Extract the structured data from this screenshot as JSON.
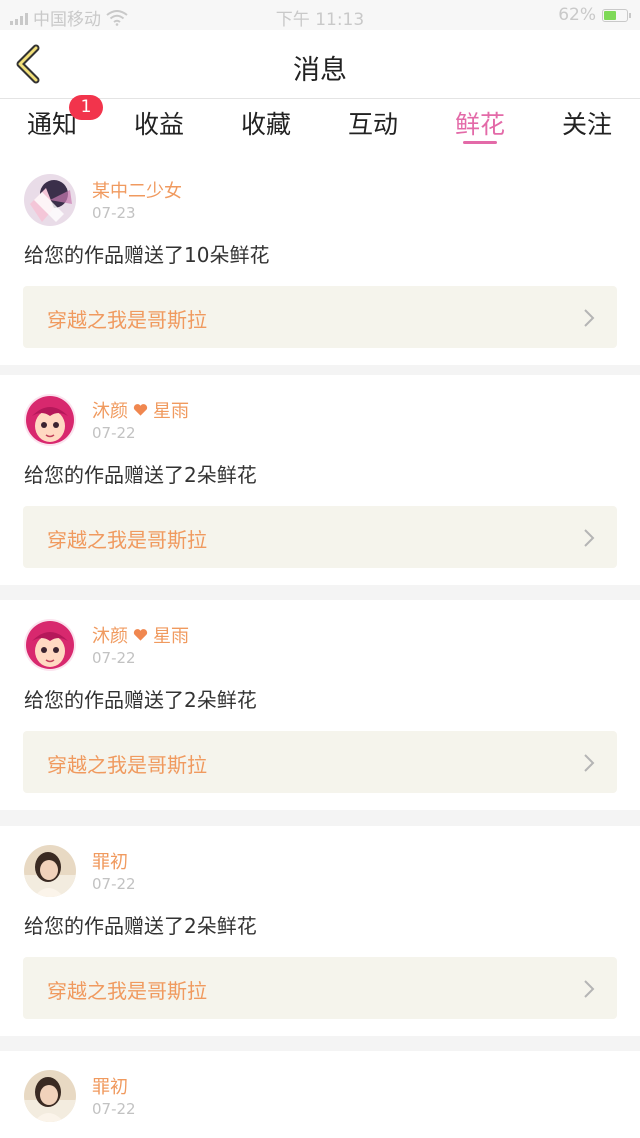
{
  "status_bar": {
    "carrier": "中国移动",
    "time": "下午 11:13",
    "battery": "62%",
    "battery_level": 0.62
  },
  "nav": {
    "title": "消息"
  },
  "tabs": [
    {
      "label": "通知",
      "badge": "1"
    },
    {
      "label": "收益"
    },
    {
      "label": "收藏"
    },
    {
      "label": "互动"
    },
    {
      "label": "鲜花",
      "active": true
    },
    {
      "label": "关注"
    }
  ],
  "colors": {
    "accent": "#e36aa8",
    "username": "#f09a5f",
    "badge": "#f2344c",
    "work_bg": "#f5f4ec"
  },
  "items": [
    {
      "avatar_icon": "anime-girl-avatar",
      "user_a": "某中二少女",
      "user_b": "",
      "date": "07-23",
      "message": "给您的作品赠送了10朵鲜花",
      "work": "穿越之我是哥斯拉"
    },
    {
      "avatar_icon": "cartoon-girl-avatar",
      "user_a": "沐颜",
      "user_b": "星雨",
      "heart": true,
      "date": "07-22",
      "message": "给您的作品赠送了2朵鲜花",
      "work": "穿越之我是哥斯拉"
    },
    {
      "avatar_icon": "cartoon-girl-avatar",
      "user_a": "沐颜",
      "user_b": "星雨",
      "heart": true,
      "date": "07-22",
      "message": "给您的作品赠送了2朵鲜花",
      "work": "穿越之我是哥斯拉"
    },
    {
      "avatar_icon": "photo-avatar",
      "user_a": "罪初",
      "user_b": "",
      "date": "07-22",
      "message": "给您的作品赠送了2朵鲜花",
      "work": "穿越之我是哥斯拉"
    },
    {
      "avatar_icon": "photo-avatar",
      "user_a": "罪初",
      "user_b": "",
      "date": "07-22",
      "message": "",
      "work": ""
    }
  ]
}
